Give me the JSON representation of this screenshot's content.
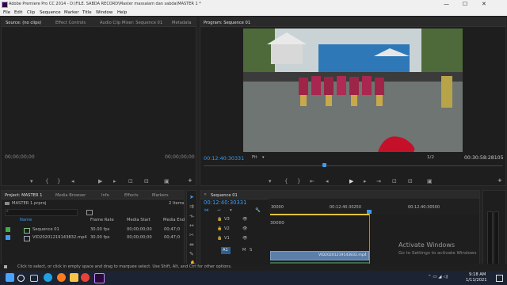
{
  "title_bar": {
    "title": "Adobe Premiere Pro CC 2014 - D:\\FILE. SABDA RECORD\\Master massalam dan sabda\\MASTER 1 *",
    "minimize": "—",
    "maximize": "☐",
    "close": "✕"
  },
  "menu": [
    "File",
    "Edit",
    "Clip",
    "Sequence",
    "Marker",
    "Title",
    "Window",
    "Help"
  ],
  "source_panel": {
    "tabs": [
      "Source: (no clips)",
      "Effect Controls",
      "Audio Clip Mixer: Sequence 01",
      "Metadata"
    ],
    "timecode_left": "00;00;00;00",
    "timecode_right": "00;00;00;00"
  },
  "program_panel": {
    "tab": "Program: Sequence 01",
    "timecode_left": "00:12:40:30331",
    "fit": "Fit",
    "resolution": "1/2",
    "timecode_right": "00:30:58:28105"
  },
  "project_panel": {
    "tabs": [
      "Project: MASTER 1",
      "Media Browser",
      "Info",
      "Effects",
      "Markers"
    ],
    "project_file": "MASTER 1.prproj",
    "item_count": "2 Items",
    "columns": [
      "Name",
      "Frame Rate",
      "Media Start",
      "Media End"
    ],
    "rows": [
      {
        "name": "Sequence 01",
        "frame_rate": "30.00 fps",
        "media_start": "00;00;00;00",
        "media_end": "00;47;0",
        "color": "#3fae49"
      },
      {
        "name": "VID20201219143832.mp4",
        "frame_rate": "30.00 fps",
        "media_start": "00;00;00;00",
        "media_end": "00;47;0",
        "color": "#3f9bf0"
      }
    ]
  },
  "timeline_panel": {
    "tab": "Sequence 01",
    "timecode": "00:12:40:30331",
    "ruler": [
      "30000",
      "00:12:40:30250",
      "00:12:40:30500"
    ],
    "tracks": [
      "V3",
      "V2",
      "V1",
      "A1"
    ],
    "clip_label": "VID20201219143832.mp4",
    "track_m": "M",
    "track_s": "S"
  },
  "watermark": {
    "line1": "Activate Windows",
    "line2": "Go to Settings to activate Windows"
  },
  "status_bar": "Click to select, or click in empty space and drag to marquee select. Use Shift, Alt, and Ctrl for other options.",
  "taskbar": {
    "time": "9:18 AM",
    "date": "1/11/2021",
    "apps": [
      "windows-start",
      "search",
      "task-view",
      "edge",
      "firefox",
      "explorer",
      "chrome",
      "premiere"
    ],
    "app_colors": [
      "#4aa3ff",
      "#ffffff",
      "#cccccc",
      "#1fa1e0",
      "#ff7a1a",
      "#f5c54a",
      "#e94235",
      "#2a0a3a"
    ]
  }
}
